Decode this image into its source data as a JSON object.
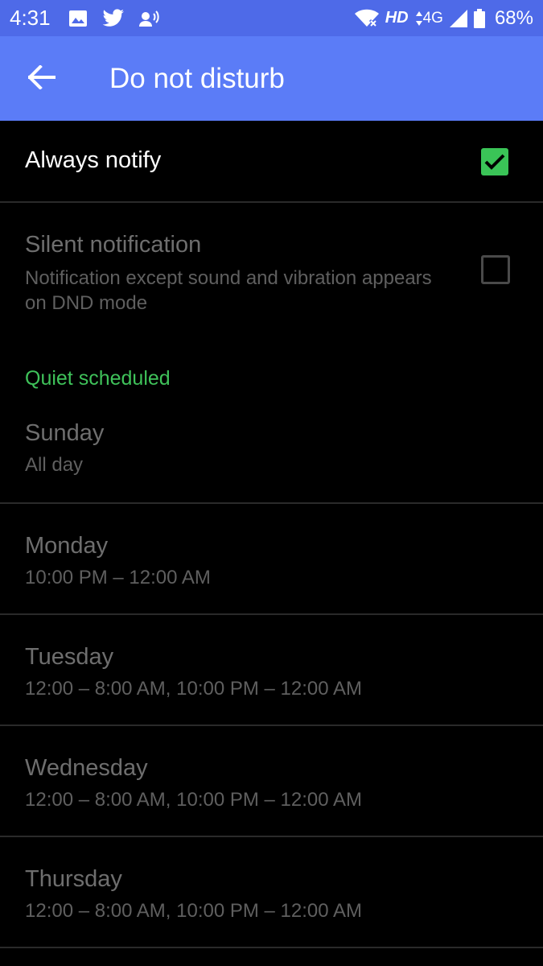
{
  "status_bar": {
    "time": "4:31",
    "hd": "HD",
    "network": "4G",
    "battery": "68%"
  },
  "app_bar": {
    "title": "Do not disturb",
    "back_icon": "arrow-back-icon"
  },
  "settings": {
    "always_notify": {
      "label": "Always notify",
      "checked": true
    },
    "silent_notification": {
      "label": "Silent notification",
      "description": "Notification except sound and vibration appears on DND mode",
      "checked": false
    }
  },
  "quiet_scheduled": {
    "header": "Quiet scheduled",
    "days": [
      {
        "name": "Sunday",
        "time": "All day"
      },
      {
        "name": "Monday",
        "time": "10:00 PM – 12:00 AM"
      },
      {
        "name": "Tuesday",
        "time": "12:00 – 8:00 AM, 10:00 PM – 12:00 AM"
      },
      {
        "name": "Wednesday",
        "time": "12:00 – 8:00 AM, 10:00 PM – 12:00 AM"
      },
      {
        "name": "Thursday",
        "time": "12:00 – 8:00 AM, 10:00 PM – 12:00 AM"
      }
    ]
  },
  "colors": {
    "status_bar": "#4e6ae8",
    "app_bar": "#5b7cf7",
    "accent_green": "#3ac457",
    "background": "#000000"
  }
}
